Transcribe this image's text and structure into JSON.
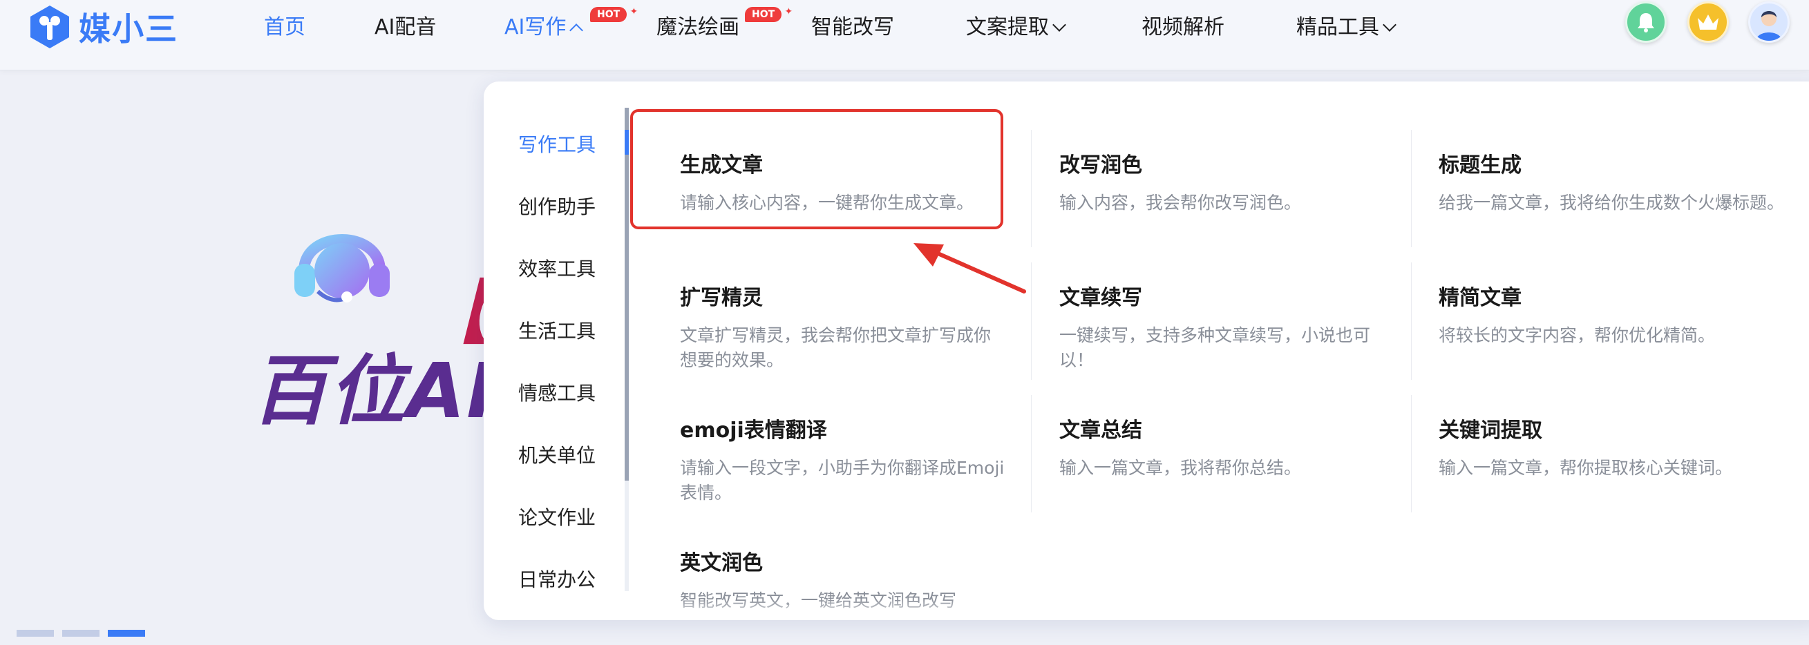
{
  "brand": {
    "name": "媒小三",
    "accent": "#3a7bf6"
  },
  "nav": [
    {
      "label": "首页",
      "active": true
    },
    {
      "label": "AI配音"
    },
    {
      "label": "AI写作",
      "hot": "HOT"
    },
    {
      "label": "魔法绘画",
      "hot": "HOT"
    },
    {
      "label": "智能改写"
    },
    {
      "label": "文案提取"
    },
    {
      "label": "视频解析"
    },
    {
      "label": "精品工具"
    }
  ],
  "header_icons": [
    "bell-icon",
    "crown-icon",
    "avatar"
  ],
  "hero": {
    "bracket": "【媒",
    "title": "百位AI配"
  },
  "dropdown": {
    "categories": [
      "写作工具",
      "创作助手",
      "效率工具",
      "生活工具",
      "情感工具",
      "机关单位",
      "论文作业",
      "日常办公"
    ],
    "active_category": "写作工具",
    "tools": [
      {
        "name": "生成文章",
        "desc": "请输入核心内容，一键帮你生成文章。"
      },
      {
        "name": "改写润色",
        "desc": "输入内容，我会帮你改写润色。"
      },
      {
        "name": "标题生成",
        "desc": "给我一篇文章，我将给你生成数个火爆标题。"
      },
      {
        "name": "扩写精灵",
        "desc": "文章扩写精灵，我会帮你把文章扩写成你想要的效果。"
      },
      {
        "name": "文章续写",
        "desc": "一键续写，支持多种文章续写，小说也可以！"
      },
      {
        "name": "精简文章",
        "desc": "将较长的文字内容，帮你优化精简。"
      },
      {
        "name": "emoji表情翻译",
        "desc": "请输入一段文字，小助手为你翻译成Emoji表情。"
      },
      {
        "name": "文章总结",
        "desc": "输入一篇文章，我将帮你总结。"
      },
      {
        "name": "关键词提取",
        "desc": "输入一篇文章，帮你提取核心关键词。"
      },
      {
        "name": "英文润色",
        "desc": "智能改写英文，一键给英文润色改写"
      }
    ]
  },
  "highlight_color": "#e2332c"
}
